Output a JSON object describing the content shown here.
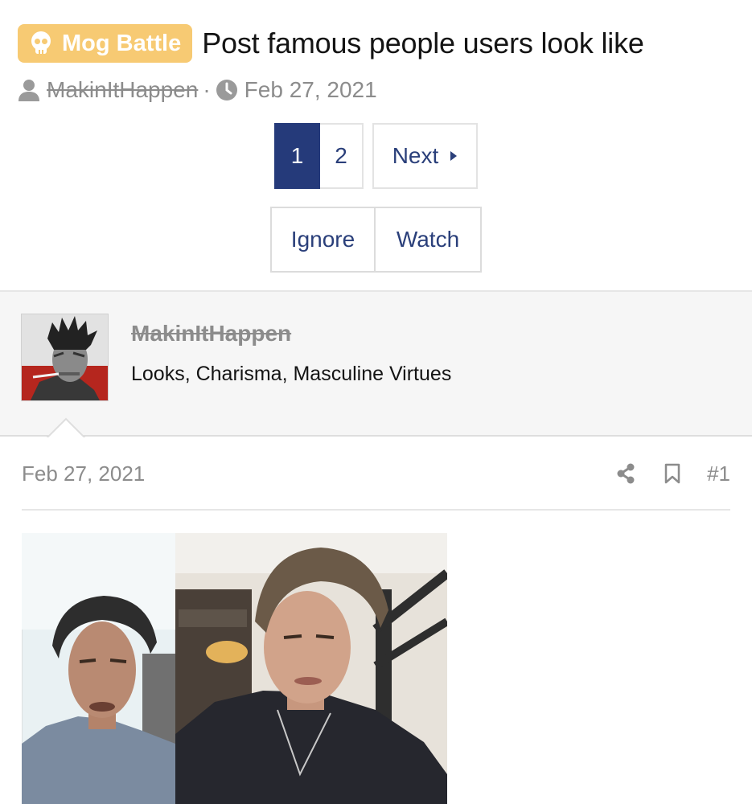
{
  "thread": {
    "prefix": "Mog Battle",
    "prefix_icon": "skull-icon",
    "title": "Post famous people users look like",
    "author": "MakinItHappen",
    "separator": "·",
    "date": "Feb 27, 2021"
  },
  "pagination": {
    "current": "1",
    "page2": "2",
    "next": "Next"
  },
  "actions": {
    "ignore": "Ignore",
    "watch": "Watch"
  },
  "post": {
    "author": "MakinItHappen",
    "user_title": "Looks, Charisma, Masculine Virtues",
    "date": "Feb 27, 2021",
    "number": "#1",
    "icons": [
      "share-icon",
      "bookmark-icon"
    ]
  },
  "colors": {
    "prefix_bg": "#f7ca73",
    "accent": "#253a7a",
    "link": "#2a3f7a",
    "muted": "#8c8c8c"
  }
}
